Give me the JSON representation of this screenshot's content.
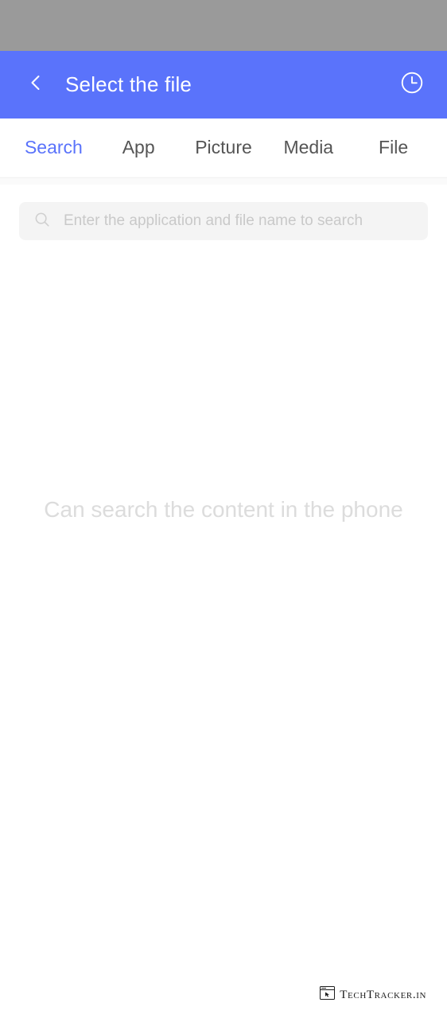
{
  "status_bar": {
    "background_color": "#9a9a9a"
  },
  "app_bar": {
    "title": "Select the file",
    "back_icon": "chevron-left-icon",
    "history_icon": "clock-icon",
    "background_color": "#5a73fb",
    "text_color": "#ffffff"
  },
  "tabs": {
    "active_color": "#5a73fb",
    "inactive_color": "#555555",
    "items": [
      {
        "label": "Search",
        "active": true
      },
      {
        "label": "App",
        "active": false
      },
      {
        "label": "Picture",
        "active": false
      },
      {
        "label": "Media",
        "active": false
      },
      {
        "label": "File",
        "active": false
      }
    ]
  },
  "search": {
    "icon": "search-icon",
    "placeholder": "Enter the application and file name to search",
    "value": "",
    "background_color": "#f4f4f4"
  },
  "empty_state": {
    "message": "Can search the content in the phone",
    "text_color": "#dcdcdc"
  },
  "watermark": {
    "label": "TechTracker.in",
    "icon": "browser-window-cursor-icon"
  }
}
